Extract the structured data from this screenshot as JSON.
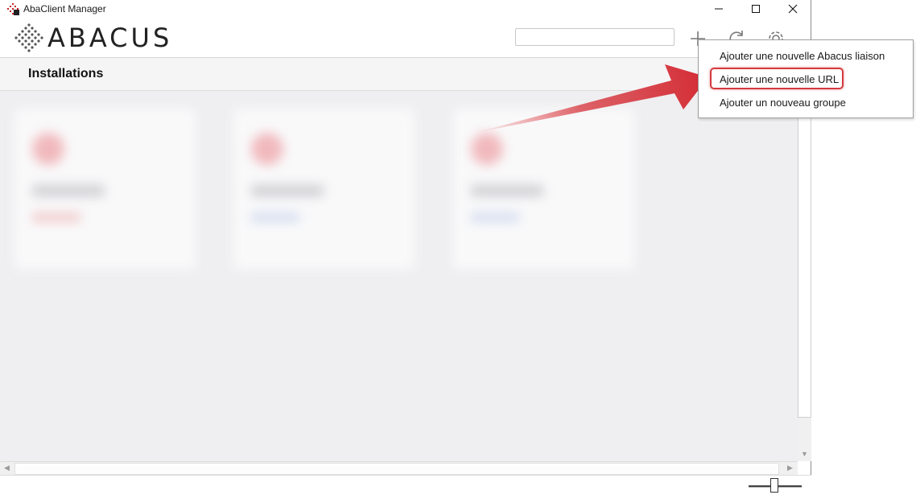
{
  "window": {
    "title": "AbaClient Manager"
  },
  "logo": {
    "text": "ABACUS"
  },
  "search": {
    "value": ""
  },
  "section": {
    "title": "Installations"
  },
  "context_menu": {
    "items": [
      {
        "label": "Ajouter une nouvelle Abacus liaison"
      },
      {
        "label": "Ajouter une nouvelle URL",
        "highlighted": true
      },
      {
        "label": "Ajouter un nouveau groupe"
      }
    ]
  },
  "colors": {
    "accent_red": "#d43a3f",
    "background": "#efeff1"
  },
  "icons": [
    "app-icon",
    "minimize-icon",
    "maximize-icon",
    "close-icon",
    "add-icon",
    "refresh-icon",
    "settings-icon",
    "zoom-slider"
  ]
}
